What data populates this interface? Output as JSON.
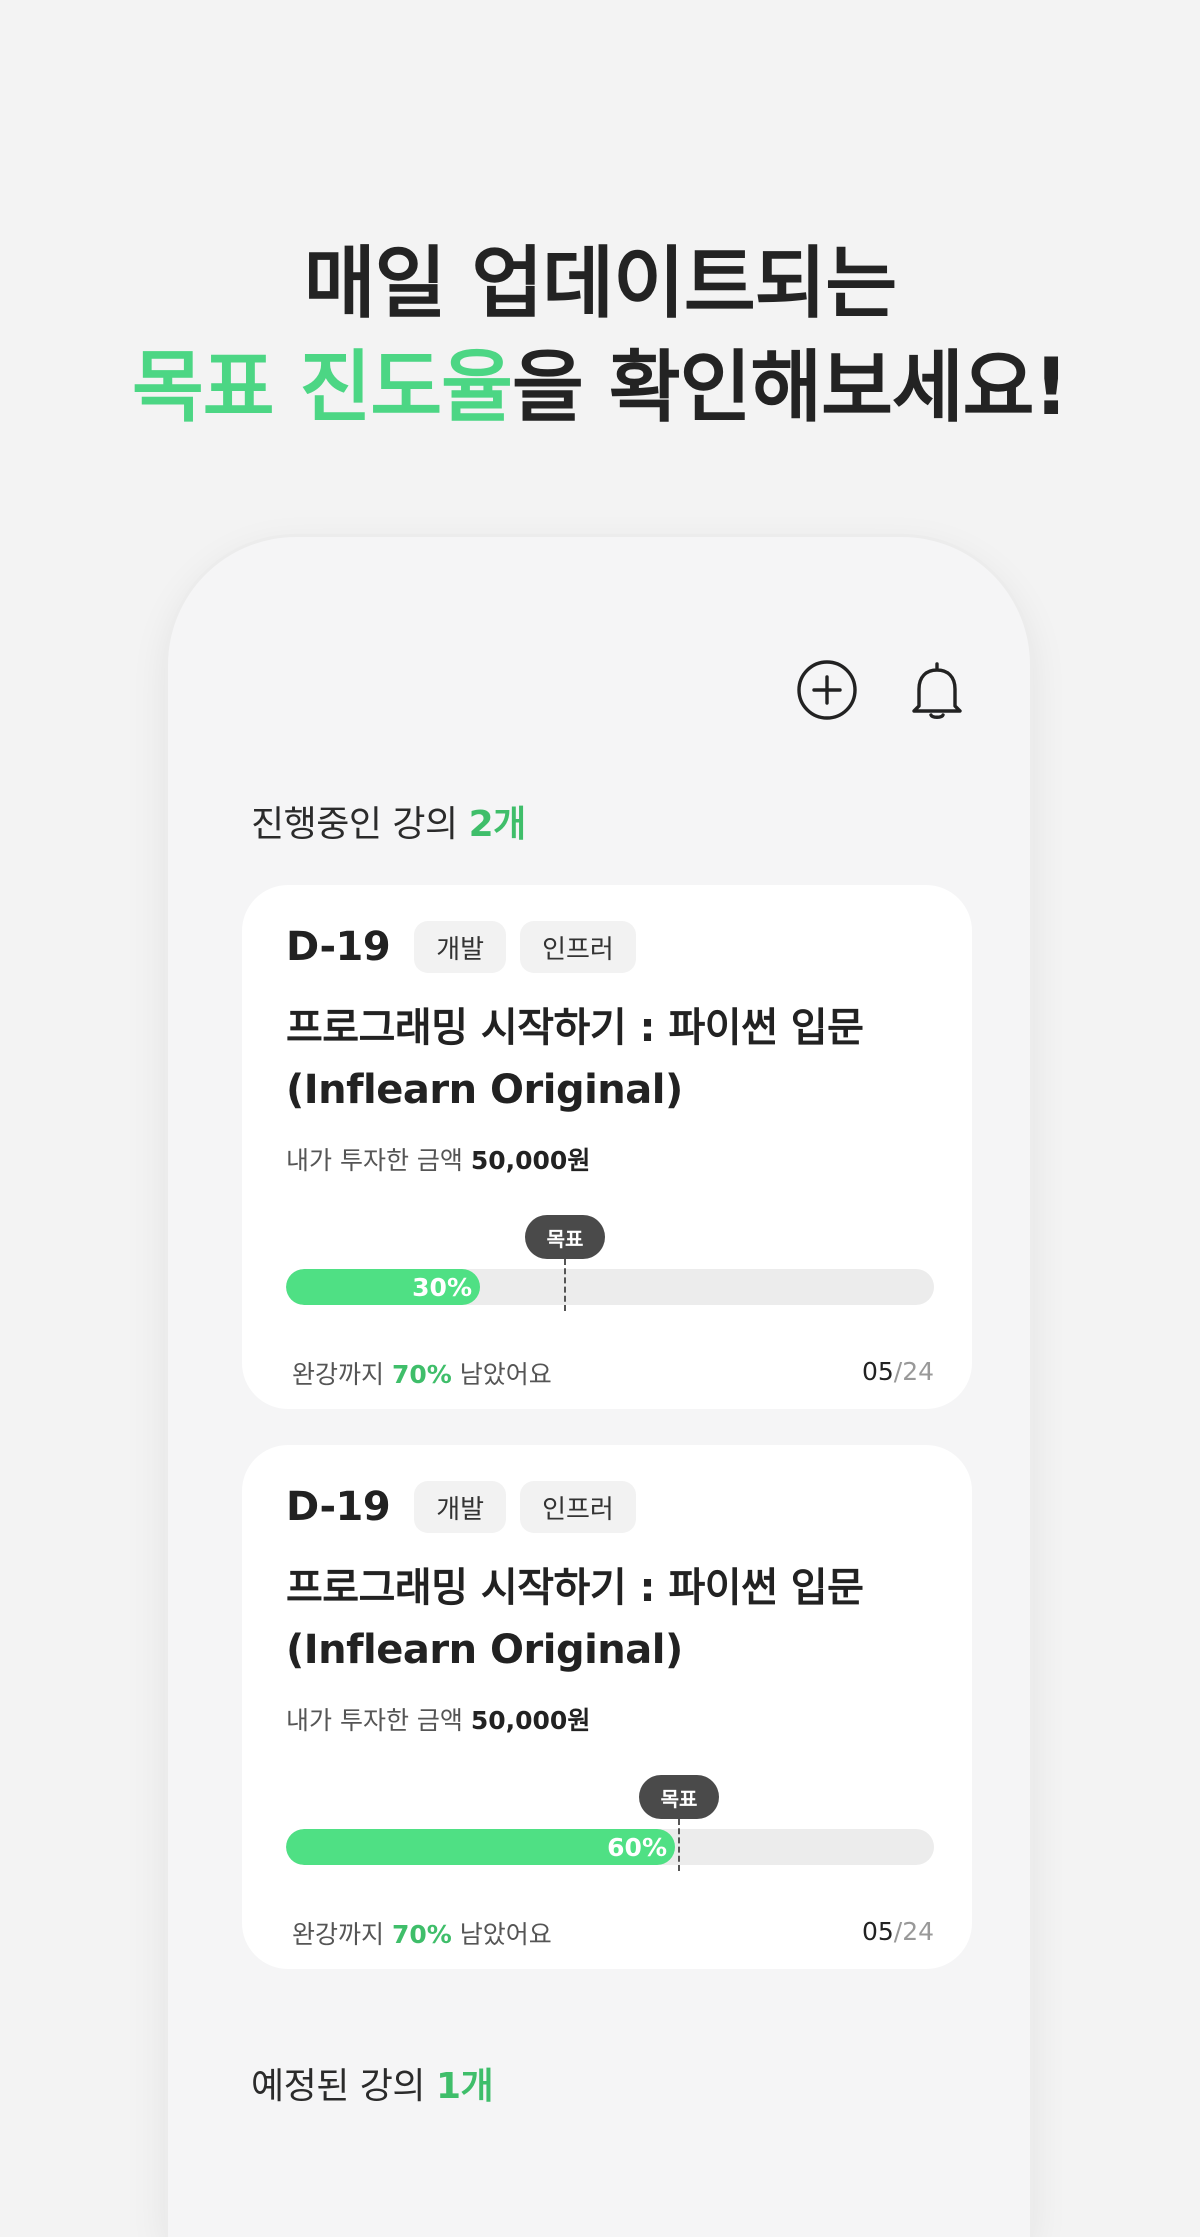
{
  "headline": {
    "line1": "매일 업데이트되는",
    "line2_accent": "목표 진도율",
    "line2_rest": "을 확인해보세요!"
  },
  "top_icons": [
    "plus-circle-icon",
    "bell-icon"
  ],
  "in_progress": {
    "label": "진행중인 강의 ",
    "count": "2개"
  },
  "courses": [
    {
      "dday": "D-19",
      "tags": [
        "개발",
        "인프러"
      ],
      "title": "프로그래밍 시작하기 : 파이썬 입문 (Inflearn Original)",
      "invest_label": "내가 투자한 금액 ",
      "invest_amount": "50,000원",
      "progress_label": "30%",
      "progress": 0.3,
      "goal_label": "목표",
      "goal": 0.43,
      "remain_prefix": "완강까지 ",
      "remain_pct": "70%",
      "remain_suffix": " 남았어요",
      "pages_current": "05",
      "pages_total": "/24"
    },
    {
      "dday": "D-19",
      "tags": [
        "개발",
        "인프러"
      ],
      "title": "프로그래밍 시작하기 : 파이썬 입문 (Inflearn Original)",
      "invest_label": "내가 투자한 금액 ",
      "invest_amount": "50,000원",
      "progress_label": "60%",
      "progress": 0.6,
      "goal_label": "목표",
      "goal": 0.606,
      "remain_prefix": "완강까지 ",
      "remain_pct": "70%",
      "remain_suffix": " 남았어요",
      "pages_current": "05",
      "pages_total": "/24"
    }
  ],
  "scheduled": {
    "label": "예정된 강의 ",
    "count": "1개"
  },
  "colors": {
    "accent": "#4cd684",
    "progress_fill": "#4fe084",
    "goal_pill": "#4a4a4a"
  }
}
